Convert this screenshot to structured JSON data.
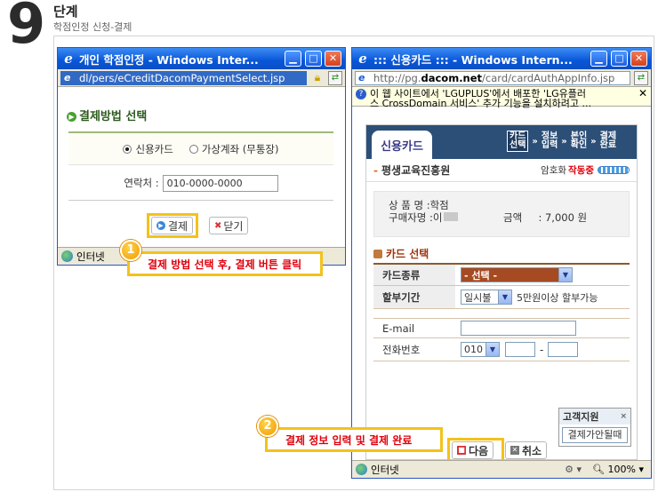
{
  "step": {
    "number": "9",
    "word": "단계",
    "subtitle": "학점인정 신청-결제"
  },
  "left_window": {
    "title": "개인 학점인정 - Windows Inter...",
    "address": "dl/pers/eCreditDacomPaymentSelect.jsp",
    "section_title": "결제방법 선택",
    "radio_card": "신용카드",
    "radio_account": "가상계좌 (무통장)",
    "contact_label": "연락처 :",
    "contact_value": "010-0000-0000",
    "pay_button": "결제",
    "close_button": "닫기",
    "status": "인터넷"
  },
  "callout1": {
    "num": "1",
    "text": "결제 방법 선택 후, 결제 버튼 클릭"
  },
  "callout2": {
    "num": "2",
    "text": "결제 정보 입력 및 결제 완료"
  },
  "right_window": {
    "title": "::: 신용카드 ::: - Windows Intern...",
    "address_pre": "http://pg.",
    "address_bold": "dacom.net",
    "address_post": "/card/cardAuthAppInfo.jsp",
    "infobar_line1": "이 웹 사이트에서 'LGUPLUS'에서 배포한 'LG유플러",
    "infobar_line2": "스 CrossDomain 서비스' 추가 기능을 설치하려고 ...",
    "tab_label": "신용카드",
    "steps": [
      "카드\n선택",
      "정보\n입력",
      "본인\n확인",
      "결제\n완료"
    ],
    "merchant": "평생교육진흥원",
    "security_label": "암호화",
    "security_status": "작동중",
    "product_label": "상 품 명 :",
    "product_value": "학점",
    "buyer_label": "구매자명 :",
    "buyer_value": "이",
    "amount_label": "금액",
    "amount_value": ": 7,000 원",
    "card_section": "카드 선택",
    "card_type_label": "카드종류",
    "card_type_value": "- 선택 -",
    "installment_label": "할부기간",
    "installment_value": "일시불",
    "installment_note": "5만원이상 할부가능",
    "email_label": "E-mail",
    "phone_label": "전화번호",
    "phone_prefix": "010",
    "phone_dash": "-",
    "support_title": "고객지원",
    "support_close": "×",
    "support_link": "결제가안될때",
    "next_button": "다음",
    "cancel_button": "취소",
    "status": "인터넷",
    "zoom": "100%"
  },
  "colors": {
    "accent_yellow": "#f3c21b",
    "callout_red": "#e0000c",
    "xp_blue": "#0856d8",
    "card_header": "#2c4f78"
  }
}
